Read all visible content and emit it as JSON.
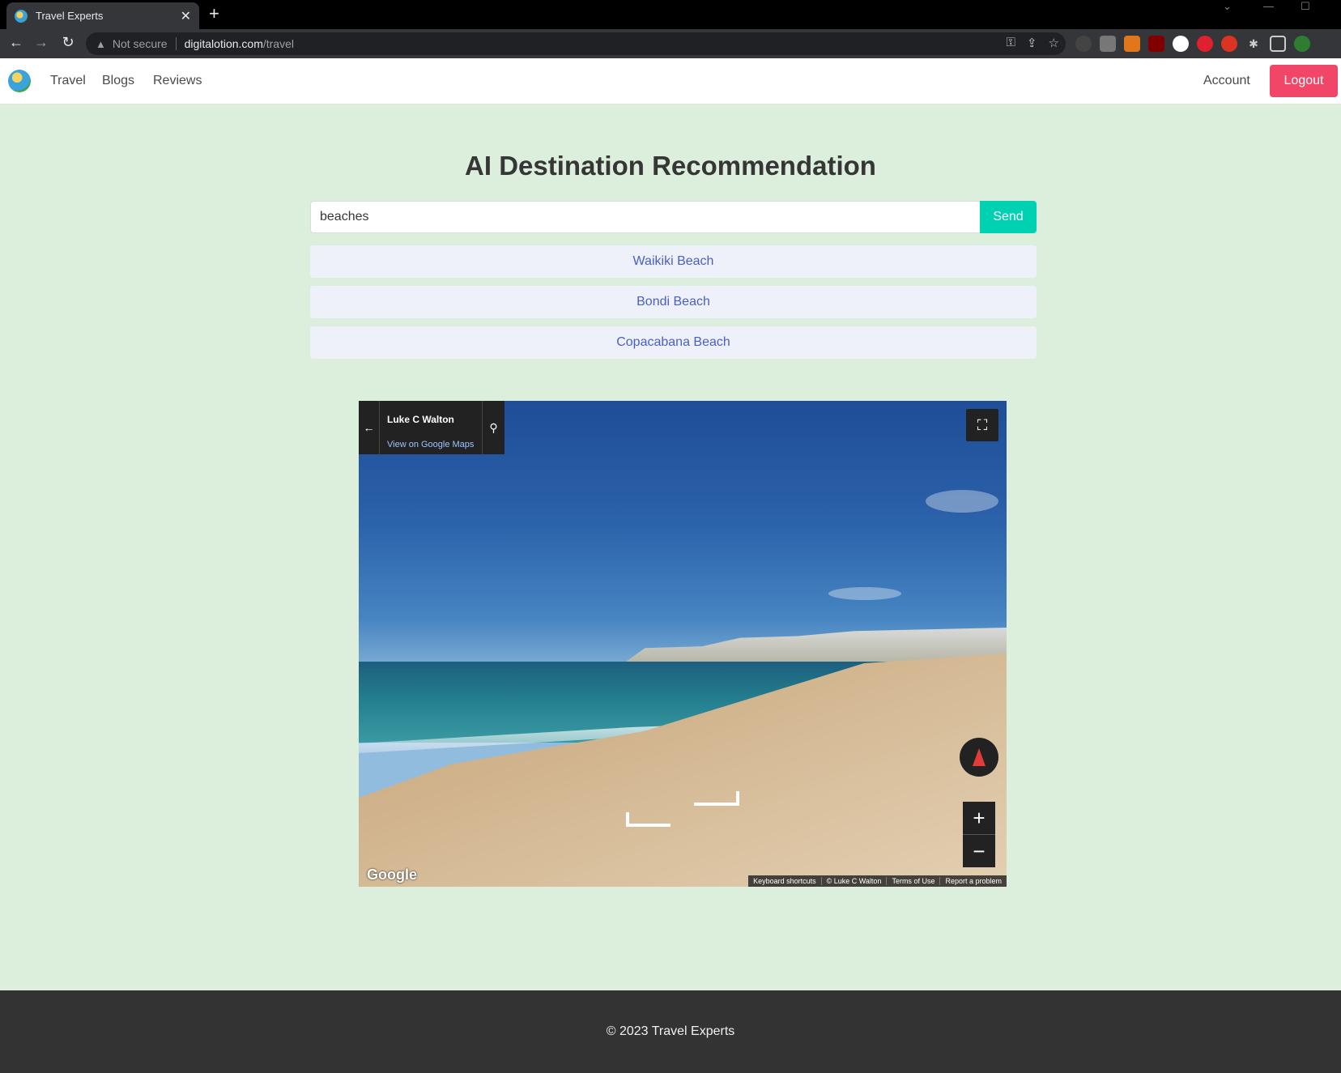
{
  "browser": {
    "tab_title": "Travel Experts",
    "new_tab_glyph": "+",
    "close_glyph": "✕",
    "security_label": "Not secure",
    "url_host": "digitalotion.com",
    "url_path": "/travel",
    "icons": [
      "back-icon",
      "forward-icon",
      "reload-icon",
      "key-icon",
      "share-icon",
      "star-icon",
      "extensions-icon",
      "sidepanel-icon",
      "profile-icon"
    ]
  },
  "navbar": {
    "links": [
      "Travel",
      "Blogs",
      "Reviews"
    ],
    "account_label": "Account",
    "logout_label": "Logout"
  },
  "main": {
    "title": "AI Destination Recommendation",
    "search_value": "beaches",
    "send_label": "Send",
    "results": [
      "Waikiki Beach",
      "Bondi Beach",
      "Copacabana Beach"
    ]
  },
  "streetview": {
    "author": "Luke C Walton",
    "maps_link": "View on Google Maps",
    "brand": "Google",
    "footer": [
      "Keyboard shortcuts",
      "© Luke C Walton",
      "Terms of Use",
      "Report a problem"
    ],
    "zoom_in": "+",
    "zoom_out": "−"
  },
  "footer": {
    "copyright": "© 2023 Travel Experts"
  },
  "colors": {
    "page_bg": "#dcefdc",
    "primary": "#00d1b2",
    "danger": "#f14668",
    "link": "#485fc7"
  }
}
